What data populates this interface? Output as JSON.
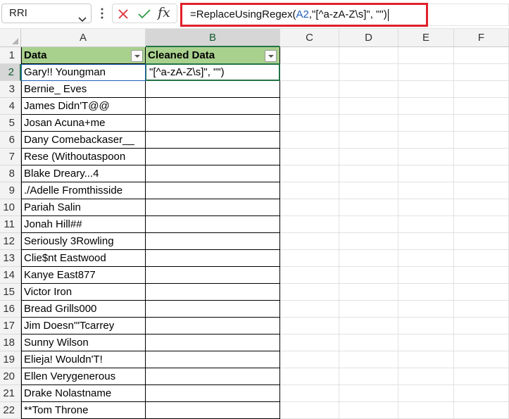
{
  "name_box": {
    "value": "RRI"
  },
  "formula_bar": {
    "fx_label": "fx",
    "prefix": "=ReplaceUsingRegex(",
    "ref": "A2",
    "suffix": ",\"[^a-zA-Z\\s]\", \"\")"
  },
  "columns": [
    "A",
    "B",
    "C",
    "D",
    "E",
    "F"
  ],
  "rows": [
    "1",
    "2",
    "3",
    "4",
    "5",
    "6",
    "7",
    "8",
    "9",
    "10",
    "11",
    "12",
    "13",
    "14",
    "15",
    "16",
    "17",
    "18",
    "19",
    "20",
    "21",
    "22"
  ],
  "table": {
    "header_a": "Data",
    "header_b": "Cleaned Data",
    "data": [
      "Gary!! Youngman",
      "Bernie_ Eves",
      "James Didn'T@@",
      "Josan Acuna+me",
      "Dany Comebackaser__",
      "Rese (Withoutaspoon",
      "Blake Dreary...4",
      "./Adelle Fromthisside",
      "Pariah Salin",
      "Jonah Hill##",
      "Seriously 3Rowling",
      "Clie$nt Eastwood",
      "Kanye East877",
      "Victor Iron",
      "Bread Grills000",
      "Jim Doesn'\"Tcarrey",
      "Sunny Wilson",
      "Elieja! Wouldn'T!",
      "Ellen Verygenerous",
      "Drake Nolastname",
      "**Tom Throne"
    ],
    "b2_edit_text": "\"[^a-zA-Z\\s]\", \"\")"
  },
  "colors": {
    "header_fill": "#a9d18e",
    "selection": "#217346",
    "formula_highlight": "#e0202a",
    "ref_blue": "#1f5fb8"
  },
  "icons": [
    "chevron-down-icon",
    "more-options-icon",
    "cancel-icon",
    "enter-check-icon",
    "insert-function-icon",
    "select-all-icon",
    "filter-dropdown-icon"
  ]
}
